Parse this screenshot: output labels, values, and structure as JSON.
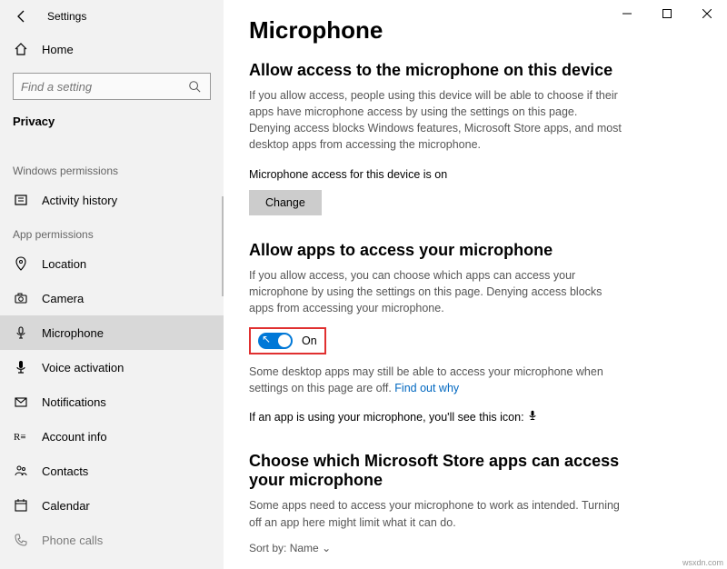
{
  "window": {
    "title": "Settings"
  },
  "sidebar": {
    "home": "Home",
    "search_placeholder": "Find a setting",
    "active_section": "Privacy",
    "group1_label": "Windows permissions",
    "group1_items": [
      {
        "label": "Activity history"
      }
    ],
    "group2_label": "App permissions",
    "group2_items": [
      {
        "label": "Location"
      },
      {
        "label": "Camera"
      },
      {
        "label": "Microphone",
        "selected": true
      },
      {
        "label": "Voice activation"
      },
      {
        "label": "Notifications"
      },
      {
        "label": "Account info"
      },
      {
        "label": "Contacts"
      },
      {
        "label": "Calendar"
      },
      {
        "label": "Phone calls"
      }
    ]
  },
  "main": {
    "page_title": "Microphone",
    "s1": {
      "heading": "Allow access to the microphone on this device",
      "desc": "If you allow access, people using this device will be able to choose if their apps have microphone access by using the settings on this page. Denying access blocks Windows features, Microsoft Store apps, and most desktop apps from accessing the microphone.",
      "status": "Microphone access for this device is on",
      "button": "Change"
    },
    "s2": {
      "heading": "Allow apps to access your microphone",
      "desc": "If you allow access, you can choose which apps can access your microphone by using the settings on this page. Denying access blocks apps from accessing your microphone.",
      "toggle_state": "On",
      "note_pre": "Some desktop apps may still be able to access your microphone when settings on this page are off. ",
      "note_link": "Find out why",
      "iconline": "If an app is using your microphone, you'll see this icon:"
    },
    "s3": {
      "heading": "Choose which Microsoft Store apps can access your microphone",
      "desc": "Some apps need to access your microphone to work as intended. Turning off an app here might limit what it can do.",
      "sort_label": "Sort by:",
      "sort_value": "Name"
    }
  },
  "watermark": "wsxdn.com"
}
